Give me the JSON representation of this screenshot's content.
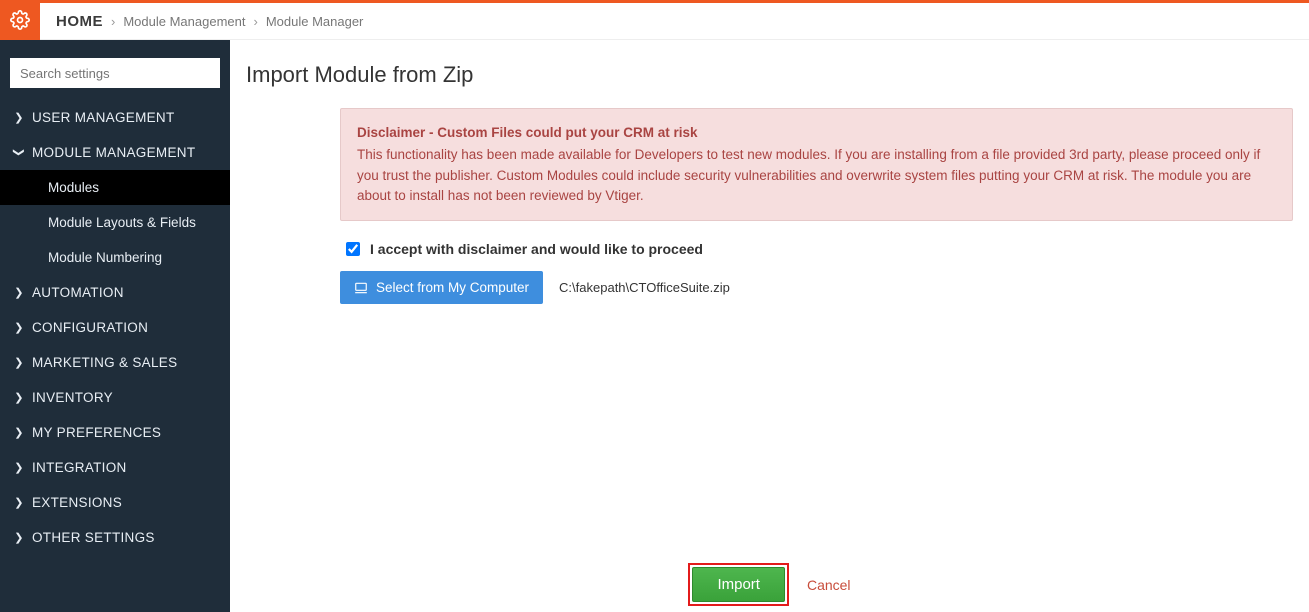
{
  "breadcrumb": {
    "home": "HOME",
    "seg1": "Module Management",
    "seg2": "Module Manager"
  },
  "search": {
    "placeholder": "Search settings"
  },
  "sidebar": {
    "user_mgmt": "USER MANAGEMENT",
    "mod_mgmt": "MODULE MANAGEMENT",
    "sub_modules": "Modules",
    "sub_layouts": "Module Layouts & Fields",
    "sub_numbering": "Module Numbering",
    "automation": "AUTOMATION",
    "configuration": "CONFIGURATION",
    "marketing": "MARKETING & SALES",
    "inventory": "INVENTORY",
    "prefs": "MY PREFERENCES",
    "integration": "INTEGRATION",
    "extensions": "EXTENSIONS",
    "other": "OTHER SETTINGS"
  },
  "page": {
    "title": "Import Module from Zip"
  },
  "disclaimer": {
    "title": "Disclaimer - Custom Files could put your CRM at risk",
    "body": "This functionality has been made available for Developers to test new modules. If you are installing from a file provided 3rd party, please proceed only if you trust the publisher. Custom Modules could include security vulnerabilities and overwrite system files putting your CRM at risk. The module you are about to install has not been reviewed by Vtiger."
  },
  "accept": {
    "label": "I accept with disclaimer and would like to proceed",
    "checked": true
  },
  "file": {
    "select_label": "Select from My Computer",
    "path": "C:\\fakepath\\CTOfficeSuite.zip"
  },
  "actions": {
    "import": "Import",
    "cancel": "Cancel"
  }
}
